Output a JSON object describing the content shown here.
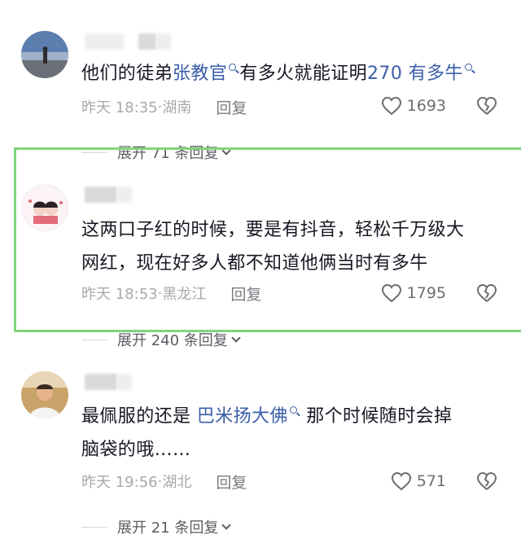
{
  "comments": [
    {
      "text_before": "他们的徒弟",
      "link1": "张教官",
      "text_middle": "有多火就能证明",
      "link2": "270 有多牛",
      "time": "昨天 18:35",
      "location": "湖南",
      "reply_label": "回复",
      "likes": "1693",
      "expand": "展开 71 条回复"
    },
    {
      "line1": "这两口子红的时候，要是有抖音，轻松千万级大",
      "line2": "网红，现在好多人都不知道他俩当时有多牛",
      "time": "昨天 18:53",
      "location": "黑龙江",
      "reply_label": "回复",
      "likes": "1795",
      "expand": "展开 240 条回复"
    },
    {
      "text_before": "最佩服的还是 ",
      "link1": "巴米扬大佛",
      "text_after": " 那个时候随时会掉",
      "line2": "脑袋的哦……",
      "time": "昨天 19:56",
      "location": "湖北",
      "reply_label": "回复",
      "likes": "571",
      "expand": "展开 21 条回复"
    }
  ],
  "colors": {
    "link": "#3b5ea8",
    "highlight": "#7fd67a",
    "meta": "#a8a9ad"
  },
  "icons": [
    "search-icon",
    "heart-icon",
    "broken-heart-icon",
    "chevron-down-icon"
  ]
}
